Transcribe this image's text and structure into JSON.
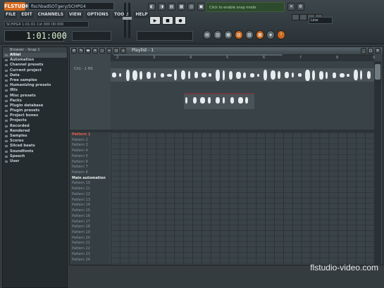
{
  "app": {
    "logo_text": "FLSTUDIO",
    "file_title": "fischbadSOTgery/SCHPG4"
  },
  "menu": [
    "FILE",
    "EDIT",
    "CHANNELS",
    "VIEW",
    "OPTIONS",
    "TOOLS",
    "HELP"
  ],
  "hint_bar": "SCHPG4 1:01:01 Cst 000 00:000",
  "time_display": "1:01:000",
  "hint_box": "Click to enable snap mode",
  "line_dropdown": "Line",
  "browser": {
    "header": "Browser - Snap 1",
    "items": [
      {
        "label": "Altiel",
        "selected": true
      },
      {
        "label": "Automation"
      },
      {
        "label": "Channel presets"
      },
      {
        "label": "Current project"
      },
      {
        "label": "Data"
      },
      {
        "label": "Free samples"
      },
      {
        "label": "Humanizing presets"
      },
      {
        "label": "IRIs"
      },
      {
        "label": "Misc presets"
      },
      {
        "label": "Packs"
      },
      {
        "label": "Plugin database"
      },
      {
        "label": "Plugin presets"
      },
      {
        "label": "Project bones"
      },
      {
        "label": "Projects"
      },
      {
        "label": "Recorded"
      },
      {
        "label": "Rendered"
      },
      {
        "label": "Samples"
      },
      {
        "label": "Scores"
      },
      {
        "label": "Sliced beats"
      },
      {
        "label": "Soundfonts"
      },
      {
        "label": "Speech"
      },
      {
        "label": "User"
      }
    ]
  },
  "playlist": {
    "title": "Playlist - 1",
    "side_label": "Ch1 - 1 HS",
    "ruler": [
      "2",
      "3",
      "4",
      "5",
      "6",
      "7",
      "8",
      "9"
    ],
    "patterns": [
      {
        "label": "Pattern 1",
        "style": "hl"
      },
      {
        "label": "Pattern 2"
      },
      {
        "label": "Pattern 3"
      },
      {
        "label": "Pattern 4"
      },
      {
        "label": "Pattern 5"
      },
      {
        "label": "Pattern 6"
      },
      {
        "label": "Pattern 7"
      },
      {
        "label": "Pattern 8"
      },
      {
        "label": "Main automation",
        "style": "bold"
      },
      {
        "label": "Pattern 10"
      },
      {
        "label": "Pattern 11"
      },
      {
        "label": "Pattern 12"
      },
      {
        "label": "Pattern 13"
      },
      {
        "label": "Pattern 14"
      },
      {
        "label": "Pattern 15"
      },
      {
        "label": "Pattern 16"
      },
      {
        "label": "Pattern 17"
      },
      {
        "label": "Pattern 18"
      },
      {
        "label": "Pattern 19"
      },
      {
        "label": "Pattern 20"
      },
      {
        "label": "Pattern 21"
      },
      {
        "label": "Pattern 22"
      },
      {
        "label": "Pattern 23"
      },
      {
        "label": "Pattern 24"
      }
    ]
  },
  "watermark": "flstudio-video.com"
}
